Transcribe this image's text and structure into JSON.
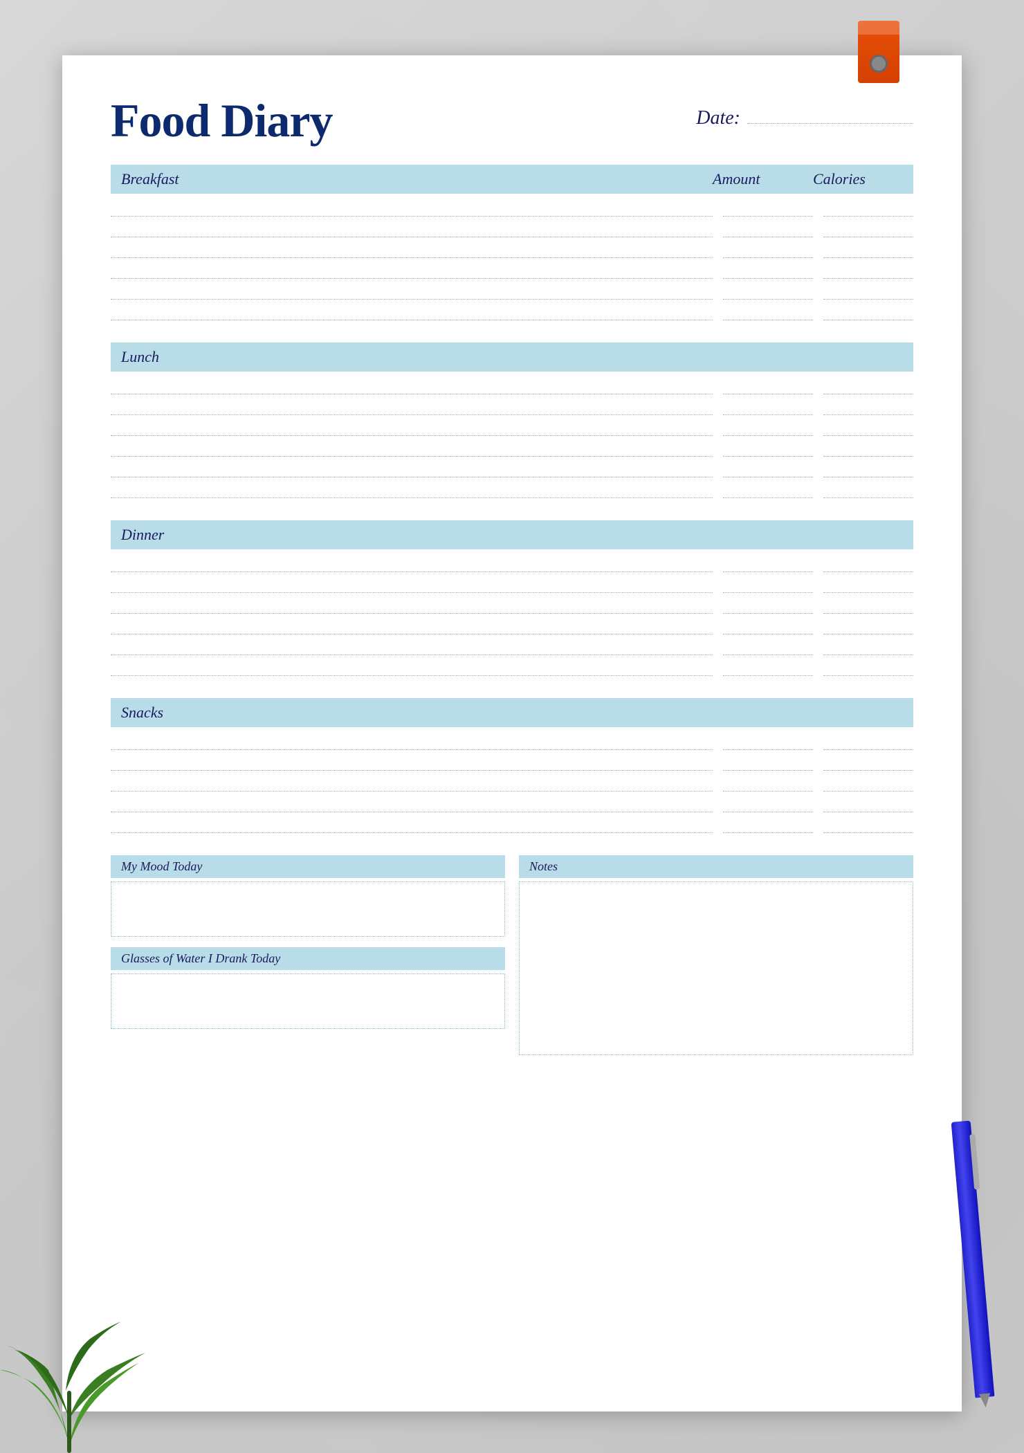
{
  "page": {
    "title": "Food Diary",
    "date_label": "Date:",
    "sections": [
      {
        "id": "breakfast",
        "label": "Breakfast",
        "rows": 6
      },
      {
        "id": "lunch",
        "label": "Lunch",
        "rows": 6
      },
      {
        "id": "dinner",
        "label": "Dinner",
        "rows": 6
      },
      {
        "id": "snacks",
        "label": "Snacks",
        "rows": 5
      }
    ],
    "column_headers": {
      "food": "Breakfast",
      "amount": "Amount",
      "calories": "Calories"
    },
    "bottom": {
      "mood_label": "My Mood Today",
      "water_label": "Glasses of Water I Drank Today",
      "notes_label": "Notes"
    }
  }
}
